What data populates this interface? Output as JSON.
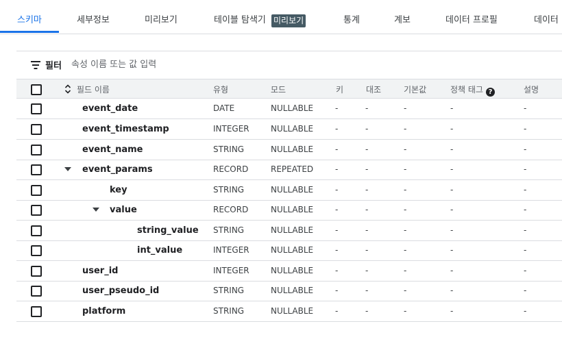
{
  "tabs": [
    {
      "label": "스키마"
    },
    {
      "label": "세부정보"
    },
    {
      "label": "미리보기"
    },
    {
      "label": "테이블 탐색기"
    },
    {
      "label": "통계"
    },
    {
      "label": "계보"
    },
    {
      "label": "데이터 프로필"
    },
    {
      "label": "데이터"
    }
  ],
  "tab_badge": "미리보기",
  "filter": {
    "label": "필터",
    "placeholder": "속성 이름 또는 값 입력"
  },
  "columns": {
    "field_name": "필드 이름",
    "type": "유형",
    "mode": "모드",
    "key": "키",
    "collation": "대조",
    "default": "기본값",
    "policy_tags": "정책 태그",
    "description": "설명"
  },
  "help_icon": "?",
  "rows": [
    {
      "name": "event_date",
      "type": "DATE",
      "mode": "NULLABLE",
      "key": "-",
      "collation": "-",
      "default": "-",
      "policy": "-",
      "description": "-"
    },
    {
      "name": "event_timestamp",
      "type": "INTEGER",
      "mode": "NULLABLE",
      "key": "-",
      "collation": "-",
      "default": "-",
      "policy": "-",
      "description": "-"
    },
    {
      "name": "event_name",
      "type": "STRING",
      "mode": "NULLABLE",
      "key": "-",
      "collation": "-",
      "default": "-",
      "policy": "-",
      "description": "-"
    },
    {
      "name": "event_params",
      "type": "RECORD",
      "mode": "REPEATED",
      "key": "-",
      "collation": "-",
      "default": "-",
      "policy": "-",
      "description": "-"
    },
    {
      "name": "key",
      "type": "STRING",
      "mode": "NULLABLE",
      "key": "-",
      "collation": "-",
      "default": "-",
      "policy": "-",
      "description": "-"
    },
    {
      "name": "value",
      "type": "RECORD",
      "mode": "NULLABLE",
      "key": "-",
      "collation": "-",
      "default": "-",
      "policy": "-",
      "description": "-"
    },
    {
      "name": "string_value",
      "type": "STRING",
      "mode": "NULLABLE",
      "key": "-",
      "collation": "-",
      "default": "-",
      "policy": "-",
      "description": "-"
    },
    {
      "name": "int_value",
      "type": "INTEGER",
      "mode": "NULLABLE",
      "key": "-",
      "collation": "-",
      "default": "-",
      "policy": "-",
      "description": "-"
    },
    {
      "name": "user_id",
      "type": "INTEGER",
      "mode": "NULLABLE",
      "key": "-",
      "collation": "-",
      "default": "-",
      "policy": "-",
      "description": "-"
    },
    {
      "name": "user_pseudo_id",
      "type": "STRING",
      "mode": "NULLABLE",
      "key": "-",
      "collation": "-",
      "default": "-",
      "policy": "-",
      "description": "-"
    },
    {
      "name": "platform",
      "type": "STRING",
      "mode": "NULLABLE",
      "key": "-",
      "collation": "-",
      "default": "-",
      "policy": "-",
      "description": "-"
    }
  ],
  "colors": {
    "accent": "#1a73e8",
    "badge": "#455a64",
    "header_bg": "#f1f3f4"
  }
}
